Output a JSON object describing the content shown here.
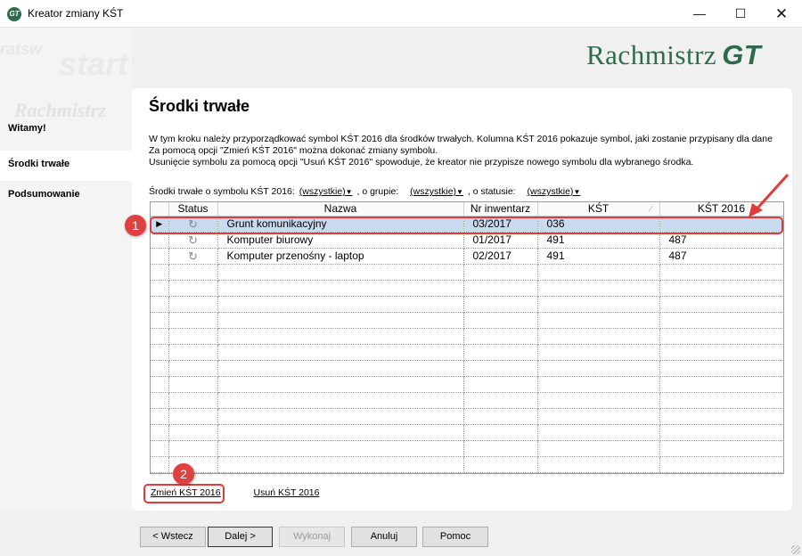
{
  "window": {
    "title": "Kreator zmiany KŚT",
    "icon": "gt-app-icon",
    "controls": [
      "minimize-icon",
      "maximize-icon",
      "close-icon"
    ]
  },
  "logo": {
    "text": "Rachmistrz",
    "mark": "GT"
  },
  "sidebar": {
    "decor": [
      "ratsw",
      "start",
      "Rachmistrz"
    ],
    "items": [
      {
        "label": "Witamy!"
      },
      {
        "label": "Środki trwałe"
      },
      {
        "label": "Podsumowanie"
      }
    ]
  },
  "main": {
    "title": "Środki trwałe",
    "description": [
      "W tym kroku należy przyporządkować symbol KŚT 2016 dla środków trwałych. Kolumna KŚT 2016 pokazuje symbol, jaki zostanie przypisany dla dane",
      "Za pomocą opcji \"Zmień KŚT 2016\" można dokonać zmiany symbolu.",
      "Usunięcie symbolu za pomocą opcji \"Usuń KŚT 2016\" spowoduje, że kreator nie przypisze nowego symbolu dla wybranego środka."
    ],
    "filter": {
      "prefix": "Środki trwałe o symbolu KŚT 2016:",
      "symbol_value": "(wszystkie)",
      "group_label": ", o grupie:",
      "group_value": "(wszystkie)",
      "status_label": ", o statusie:",
      "status_value": "(wszystkie)"
    },
    "table": {
      "columns": [
        "Status",
        "Nazwa",
        "Nr inwentarz",
        "KŚT",
        "KŚT 2016"
      ],
      "rows": [
        {
          "status": "↻",
          "name": "Grunt komunikacyjny",
          "inv": "03/2017",
          "kst": "036",
          "kst2016": ""
        },
        {
          "status": "↻",
          "name": "Komputer biurowy",
          "inv": "01/2017",
          "kst": "491",
          "kst2016": "487"
        },
        {
          "status": "↻",
          "name": "Komputer przenośny - laptop",
          "inv": "02/2017",
          "kst": "491",
          "kst2016": "487"
        }
      ],
      "selected_indicator": "▶"
    },
    "actions": {
      "change": "Zmień KŚT 2016",
      "remove": "Usuń KŚT 2016"
    }
  },
  "annotations": {
    "marker1": "1",
    "marker2": "2",
    "color": "#e23a3a"
  },
  "footer": {
    "back": "< Wstecz",
    "next": "Dalej >",
    "finish": "Wykonaj",
    "cancel": "Anuluj",
    "help": "Pomoc"
  },
  "colors": {
    "brand": "#2e6b4c",
    "selection": "#c9d9ee"
  }
}
